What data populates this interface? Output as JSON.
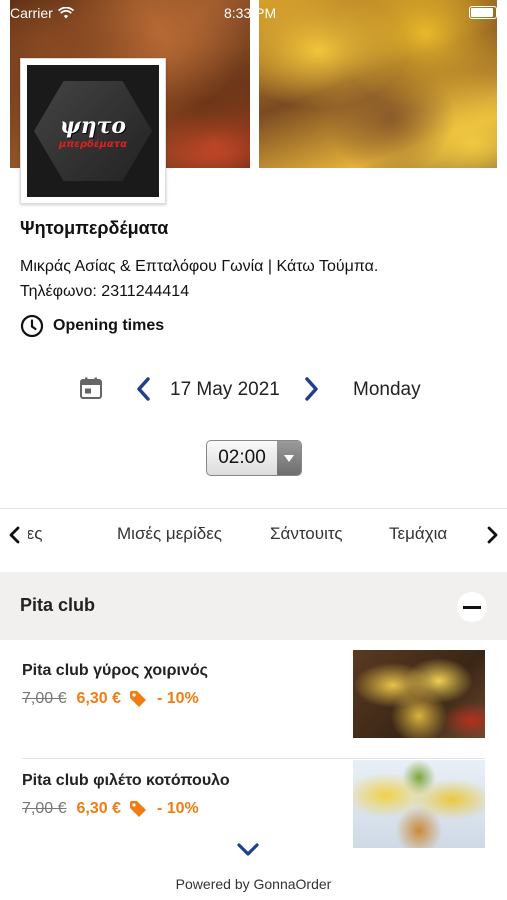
{
  "status_bar": {
    "carrier": "Carrier",
    "time": "8:33 PM"
  },
  "shop": {
    "logo_text": "ψητο",
    "logo_sub": "μπερδέματα",
    "name": "Ψητομπερδέματα",
    "address": "Μικράς Ασίας & Επταλόφου Γωνία | Κάτω Τούμπα.",
    "phone": "Τηλέφωνο: 2311244414",
    "opening_times_label": "Opening times"
  },
  "date_picker": {
    "date": "17 May 2021",
    "day": "Monday"
  },
  "time_select": {
    "value": "02:00"
  },
  "categories": {
    "tabs": [
      "Μερίδες",
      "Μισές μερίδες",
      "Σάντουιτς",
      "Τεμάχια"
    ]
  },
  "section": {
    "title": "Pita club"
  },
  "items": [
    {
      "name": "Pita club γύρος χοιρινός",
      "old_price": "7,00 €",
      "new_price": "6,30 €",
      "discount": "- 10%"
    },
    {
      "name": "Pita club φιλέτο κοτόπουλο",
      "old_price": "7,00 €",
      "new_price": "6,30 €",
      "discount": "- 10%"
    }
  ],
  "footer": {
    "powered_by": "Powered by GonnaOrder"
  },
  "colors": {
    "accent": "#f07d14",
    "nav_blue": "#1f3f8f",
    "section_bg": "#f1f0ef"
  }
}
